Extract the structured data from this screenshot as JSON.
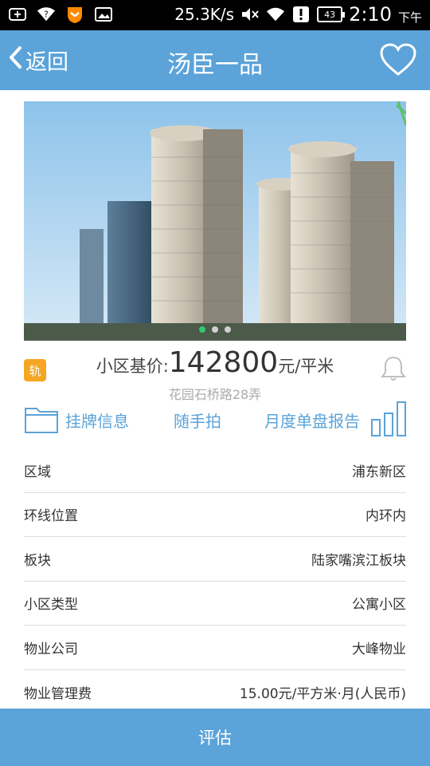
{
  "status_bar": {
    "speed": "25.3K/s",
    "battery": "43",
    "time": "2:10",
    "ampm": "下午",
    "icons": [
      "notification-plus-icon",
      "wifi-question-icon",
      "shield-app-icon",
      "image-icon",
      "mute-icon",
      "wifi-icon",
      "alert-icon",
      "battery-icon"
    ]
  },
  "header": {
    "back_label": "返回",
    "title": "汤臣一品",
    "fav_icon": "heart-outline-icon"
  },
  "gallery": {
    "image_name": "building-photo",
    "pages": 3,
    "active_page": 1
  },
  "price": {
    "badge": "轨",
    "label": "小区基价:",
    "value": "142800",
    "unit": "元/平米",
    "address": "花园石桥路28弄"
  },
  "actions": {
    "listing": "挂牌信息",
    "snapshot": "随手拍",
    "report": "月度单盘报告"
  },
  "info_rows": [
    {
      "label": "区域",
      "value": "浦东新区"
    },
    {
      "label": "环线位置",
      "value": "内环内"
    },
    {
      "label": "板块",
      "value": "陆家嘴滨江板块"
    },
    {
      "label": "小区类型",
      "value": "公寓小区"
    },
    {
      "label": "物业公司",
      "value": "大峰物业"
    },
    {
      "label": "物业管理费",
      "value": "15.00元/平方米·月(人民币)"
    }
  ],
  "bottom_button": "评估",
  "colors": {
    "accent": "#5ba3d9",
    "badge": "#f5a623",
    "active_dot": "#2ecc71"
  }
}
